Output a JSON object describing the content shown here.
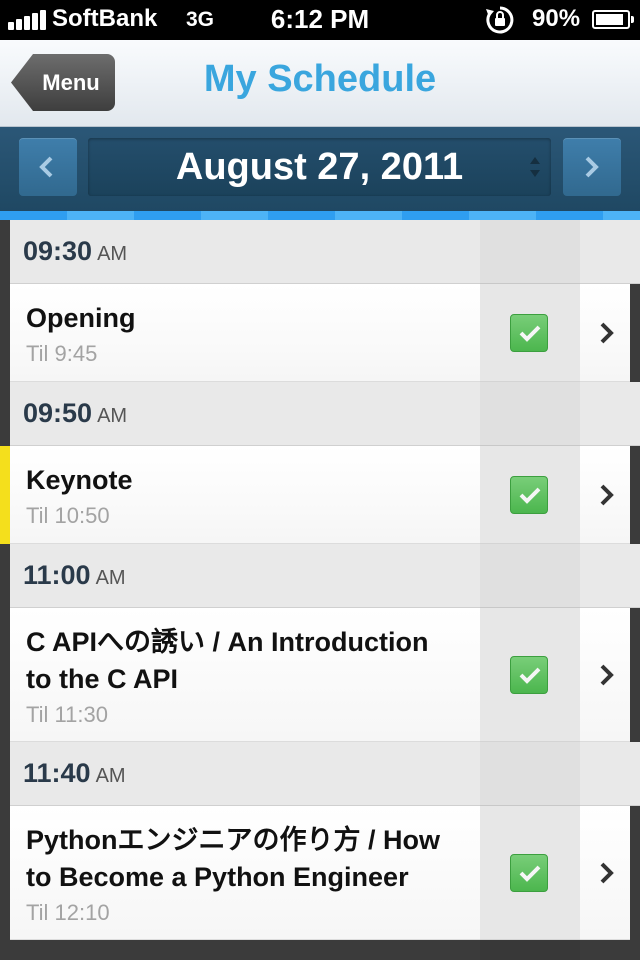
{
  "status_bar": {
    "carrier": "SoftBank",
    "network": "3G",
    "time": "6:12 PM",
    "battery_text": "90%",
    "battery_level": 0.9,
    "icons": [
      "signal-bars-icon",
      "rotation-lock-icon",
      "battery-icon"
    ]
  },
  "nav": {
    "menu_label": "Menu",
    "title": "My Schedule",
    "title_color": "#3aa6de"
  },
  "date_bar": {
    "date": "August 27, 2011",
    "prev_icon": "chevron-left-icon",
    "next_icon": "chevron-right-icon"
  },
  "schedule": [
    {
      "time": "09:30",
      "ampm": "AM",
      "title_lines": [
        "Opening"
      ],
      "until": "Til 9:45",
      "checked": true,
      "accent": "none"
    },
    {
      "time": "09:50",
      "ampm": "AM",
      "title_lines": [
        "Keynote"
      ],
      "until": "Til 10:50",
      "checked": true,
      "accent": "#f4df1c"
    },
    {
      "time": "11:00",
      "ampm": "AM",
      "title_lines": [
        "C APIへの誘い / An Introduction",
        "to the C API"
      ],
      "until": "Til 11:30",
      "checked": true,
      "accent": "none"
    },
    {
      "time": "11:40",
      "ampm": "AM",
      "title_lines": [
        "Pythonエンジニアの作り方 / How",
        "to Become a Python Engineer"
      ],
      "until": "Til 12:10",
      "checked": true,
      "accent": "none"
    }
  ],
  "colors": {
    "check_green": "#5cc65e",
    "date_bar_bg": "#234f6e",
    "stripe_blue": "#2f9ef0"
  }
}
